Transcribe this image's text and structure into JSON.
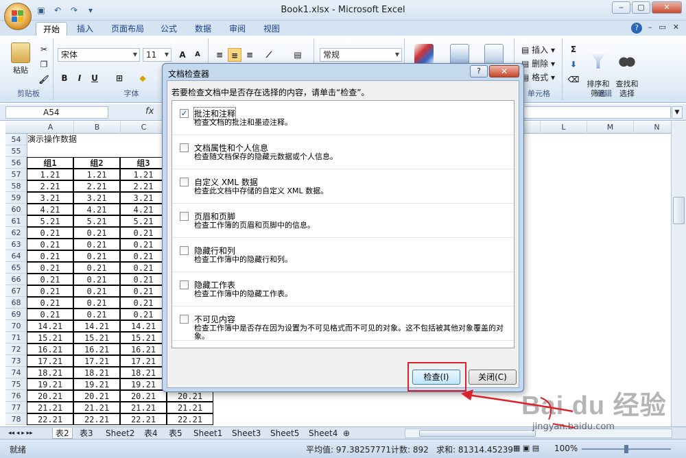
{
  "window": {
    "title": "Book1.xlsx - Microsoft Excel"
  },
  "ribbon": {
    "tabs": [
      "开始",
      "插入",
      "页面布局",
      "公式",
      "数据",
      "审阅",
      "视图"
    ],
    "active_tab": "开始",
    "clipboard": {
      "paste_label": "粘贴",
      "group_label": "剪贴板"
    },
    "font": {
      "name": "宋体",
      "size": "11",
      "bold": "B",
      "italic": "I",
      "underline": "U",
      "group_label": "字体"
    },
    "number": {
      "format": "常规"
    },
    "cells": {
      "insert": "插入",
      "delete": "删除",
      "format": "格式",
      "group_label": "单元格"
    },
    "editing": {
      "sort_filter": "排序和\n筛选",
      "find_select": "查找和\n选择",
      "group_label": "编辑"
    }
  },
  "formula_bar": {
    "name_box": "A54",
    "fx": "fx",
    "content": ""
  },
  "grid": {
    "columns": [
      "A",
      "B",
      "C",
      "D",
      "E",
      "F",
      "G",
      "H",
      "I",
      "J",
      "K",
      "L",
      "M",
      "N"
    ],
    "rows": [
      {
        "n": "54",
        "cells": [
          "演示操作数据",
          "",
          "",
          ""
        ]
      },
      {
        "n": "55",
        "cells": [
          "",
          "",
          "",
          ""
        ]
      },
      {
        "n": "56",
        "cells": [
          "组1",
          "组2",
          "组3",
          ""
        ]
      },
      {
        "n": "57",
        "cells": [
          "1.21",
          "1.21",
          "1.21",
          ""
        ]
      },
      {
        "n": "58",
        "cells": [
          "2.21",
          "2.21",
          "2.21",
          ""
        ]
      },
      {
        "n": "59",
        "cells": [
          "3.21",
          "3.21",
          "3.21",
          ""
        ]
      },
      {
        "n": "60",
        "cells": [
          "4.21",
          "4.21",
          "4.21",
          ""
        ]
      },
      {
        "n": "61",
        "cells": [
          "5.21",
          "5.21",
          "5.21",
          ""
        ]
      },
      {
        "n": "62",
        "cells": [
          "0.21",
          "0.21",
          "0.21",
          ""
        ]
      },
      {
        "n": "63",
        "cells": [
          "0.21",
          "0.21",
          "0.21",
          ""
        ]
      },
      {
        "n": "64",
        "cells": [
          "0.21",
          "0.21",
          "0.21",
          ""
        ]
      },
      {
        "n": "65",
        "cells": [
          "0.21",
          "0.21",
          "0.21",
          ""
        ]
      },
      {
        "n": "66",
        "cells": [
          "0.21",
          "0.21",
          "0.21",
          ""
        ]
      },
      {
        "n": "67",
        "cells": [
          "0.21",
          "0.21",
          "0.21",
          ""
        ]
      },
      {
        "n": "68",
        "cells": [
          "0.21",
          "0.21",
          "0.21",
          ""
        ]
      },
      {
        "n": "69",
        "cells": [
          "0.21",
          "0.21",
          "0.21",
          ""
        ]
      },
      {
        "n": "70",
        "cells": [
          "14.21",
          "14.21",
          "14.21",
          ""
        ]
      },
      {
        "n": "71",
        "cells": [
          "15.21",
          "15.21",
          "15.21",
          ""
        ]
      },
      {
        "n": "72",
        "cells": [
          "16.21",
          "16.21",
          "16.21",
          ""
        ]
      },
      {
        "n": "73",
        "cells": [
          "17.21",
          "17.21",
          "17.21",
          ""
        ]
      },
      {
        "n": "74",
        "cells": [
          "18.21",
          "18.21",
          "18.21",
          ""
        ]
      },
      {
        "n": "75",
        "cells": [
          "19.21",
          "19.21",
          "19.21",
          ""
        ]
      },
      {
        "n": "76",
        "cells": [
          "20.21",
          "20.21",
          "20.21",
          "20.21"
        ]
      },
      {
        "n": "77",
        "cells": [
          "21.21",
          "21.21",
          "21.21",
          "21.21"
        ]
      },
      {
        "n": "78",
        "cells": [
          "22.21",
          "22.21",
          "22.21",
          "22.21"
        ]
      }
    ]
  },
  "sheets": [
    "表2",
    "表3",
    "Sheet2",
    "表4",
    "表5",
    "Sheet1",
    "Sheet3",
    "Sheet5",
    "Sheet4"
  ],
  "active_sheet": "表2",
  "status": {
    "ready": "就绪",
    "average": "平均值: 97.38257771",
    "count": "计数: 892",
    "sum": "求和: 81314.45239",
    "zoom": "100%"
  },
  "dialog": {
    "title": "文档检查器",
    "help": "?",
    "close": "✕",
    "prompt": "若要检查文档中是否存在选择的内容，请单击“检查”。",
    "items": [
      {
        "title": "批注和注释",
        "desc": "检查文档的批注和墨迹注释。",
        "checked": true
      },
      {
        "title": "文档属性和个人信息",
        "desc": "检查随文档保存的隐藏元数据或个人信息。",
        "checked": false
      },
      {
        "title": "自定义 XML 数据",
        "desc": "检查此文档中存储的自定义 XML 数据。",
        "checked": false
      },
      {
        "title": "页眉和页脚",
        "desc": "检查工作簿的页眉和页脚中的信息。",
        "checked": false
      },
      {
        "title": "隐藏行和列",
        "desc": "检查工作簿中的隐藏行和列。",
        "checked": false
      },
      {
        "title": "隐藏工作表",
        "desc": "检查工作簿中的隐藏工作表。",
        "checked": false
      },
      {
        "title": "不可见内容",
        "desc": "检查工作簿中是否存在因为设置为不可见格式而不可见的对象。这不包括被其他对象覆盖的对象。",
        "checked": false
      }
    ],
    "inspect_button": "检查(I)",
    "close_button": "关闭(C)"
  },
  "watermark": {
    "main": "Bai du 经验",
    "sub": "jingyan.baidu.com"
  },
  "colors": {
    "annotation_red": "#d9222a",
    "ribbon_blue": "#d6e3f2"
  }
}
